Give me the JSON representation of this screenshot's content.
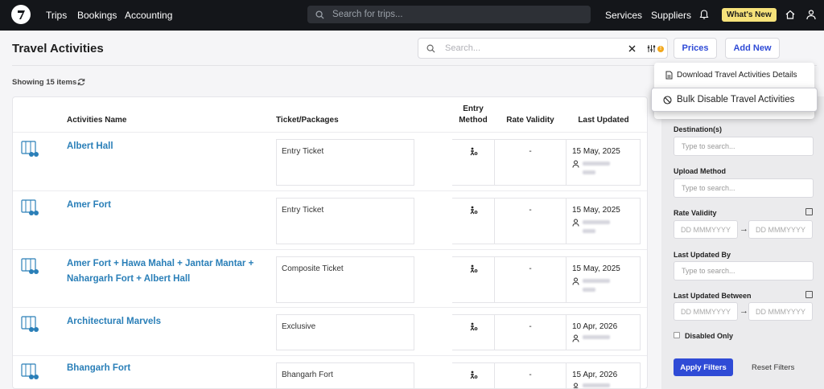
{
  "topbar": {
    "nav": [
      "Trips",
      "Bookings",
      "Accounting"
    ],
    "search_placeholder": "Search for trips...",
    "right_nav": [
      "Services",
      "Suppliers"
    ],
    "whats_new": "What's New"
  },
  "page": {
    "title": "Travel Activities",
    "search_placeholder": "Search...",
    "filter_badge": "!",
    "prices_label": "Prices",
    "add_new_label": "Add New",
    "showing": "Showing 15 items"
  },
  "dropdown": {
    "item1": "Download Travel Activities Details",
    "item2": "Bulk Disable Travel Activities"
  },
  "table": {
    "headers": {
      "name": "Activities Name",
      "ticket": "Ticket/Packages",
      "entry": "Entry Method",
      "rate": "Rate Validity",
      "updated": "Last Updated"
    },
    "rows": [
      {
        "name": "Albert Hall",
        "ticket": "Entry Ticket",
        "rate": "-",
        "updated": "15 May, 2025"
      },
      {
        "name": "Amer Fort",
        "ticket": "Entry Ticket",
        "rate": "-",
        "updated": "15 May, 2025"
      },
      {
        "name": "Amer Fort + Hawa Mahal + Jantar Mantar + Nahargarh Fort + Albert Hall",
        "ticket": "Composite Ticket",
        "rate": "-",
        "updated": "15 May, 2025"
      },
      {
        "name": "Architectural Marvels",
        "ticket": "Exclusive",
        "rate": "-",
        "updated": "10 Apr, 2026"
      },
      {
        "name": "Bhangarh Fort",
        "ticket": "Bhangarh Fort",
        "rate": "-",
        "updated": "15 Apr, 2026"
      }
    ]
  },
  "filters": {
    "destination_label": "Destination(s)",
    "destination_placeholder": "Type to search...",
    "upload_label": "Upload Method",
    "upload_placeholder": "Type to search...",
    "rate_label": "Rate Validity",
    "date_placeholder": "DD MMMYYYY",
    "arrow": "→",
    "updated_by_label": "Last Updated By",
    "updated_by_placeholder": "Type to search...",
    "updated_between_label": "Last Updated Between",
    "disabled_only": "Disabled Only",
    "apply": "Apply Filters",
    "reset": "Reset Filters"
  },
  "colors": {
    "accent": "#2f4bd6",
    "link": "#2a7fb8",
    "topbar": "#14161a",
    "whats_new": "#f6e27a"
  }
}
